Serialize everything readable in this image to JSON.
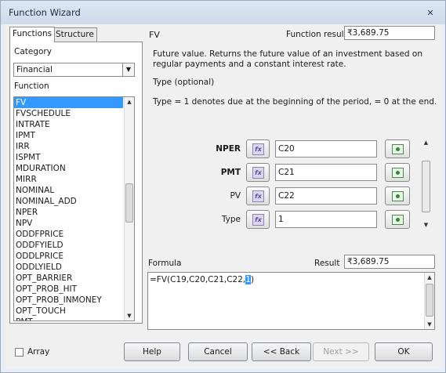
{
  "window": {
    "title": "Function Wizard",
    "close_glyph": "✕"
  },
  "tabs": [
    {
      "label": "Functions",
      "active": true
    },
    {
      "label": "Structure",
      "active": false
    }
  ],
  "category": {
    "label": "Category",
    "value": "Financial"
  },
  "function_list": {
    "label": "Function",
    "items": [
      "FV",
      "FVSCHEDULE",
      "INTRATE",
      "IPMT",
      "IRR",
      "ISPMT",
      "MDURATION",
      "MIRR",
      "NOMINAL",
      "NOMINAL_ADD",
      "NPER",
      "NPV",
      "ODDFPRICE",
      "ODDFYIELD",
      "ODDLPRICE",
      "ODDLYIELD",
      "OPT_BARRIER",
      "OPT_PROB_HIT",
      "OPT_PROB_INMONEY",
      "OPT_TOUCH",
      "PMT"
    ],
    "selected": "FV"
  },
  "function_name": "FV",
  "function_result": {
    "label": "Function result",
    "value": "₹3,689.75"
  },
  "description": "Future value. Returns the future value of an investment based on regular payments and a constant interest rate.",
  "param_name": "Type (optional)",
  "param_desc": "Type = 1 denotes due at the beginning of the period, = 0 at the end.",
  "arguments": [
    {
      "label": "NPER",
      "value": "C20",
      "bold": true
    },
    {
      "label": "PMT",
      "value": "C21",
      "bold": true
    },
    {
      "label": "PV",
      "value": "C22",
      "bold": false
    },
    {
      "label": "Type",
      "value": "1",
      "bold": false
    }
  ],
  "fx_label": "fx",
  "formula": {
    "label": "Formula",
    "prefix": "=FV(C19,C20,C21,C22,",
    "highlight": "1",
    "suffix": ")"
  },
  "result": {
    "label": "Result",
    "value": "₹3,689.75"
  },
  "array_label": "Array",
  "buttons": {
    "help": "Help",
    "cancel": "Cancel",
    "back": "<< Back",
    "next": "Next >>",
    "ok": "OK"
  },
  "icons": {
    "dropdown": "chevron-down-icon",
    "scroll_up": "scroll-up-icon",
    "scroll_down": "scroll-down-icon",
    "fx": "function-wizard-icon",
    "shrink": "shrink-icon"
  }
}
